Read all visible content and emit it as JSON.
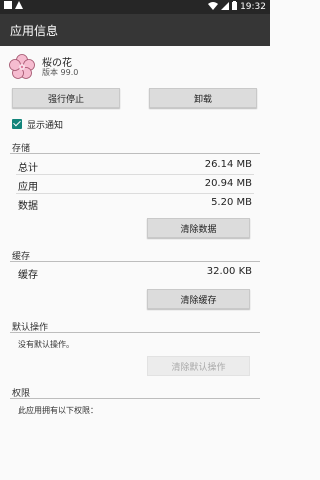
{
  "status_bar": {
    "time": "19:32",
    "icons": [
      "notification-square-icon",
      "notification-triangle-icon",
      "wifi-icon",
      "signal-icon",
      "battery-icon"
    ]
  },
  "app_bar": {
    "title": "应用信息"
  },
  "app": {
    "name": "桜の花",
    "version": "版本 99.0",
    "icon": "sakura-flower-icon"
  },
  "buttons": {
    "force_stop": "强行停止",
    "uninstall": "卸载",
    "clear_data": "清除数据",
    "clear_cache": "清除缓存",
    "clear_defaults": "清除默认操作"
  },
  "notifications": {
    "label": "显示通知",
    "checked": true
  },
  "storage": {
    "header": "存储",
    "rows": [
      {
        "label": "总计",
        "value": "26.14 MB"
      },
      {
        "label": "应用",
        "value": "20.94 MB"
      },
      {
        "label": "数据",
        "value": "5.20 MB"
      }
    ]
  },
  "cache": {
    "header": "缓存",
    "label": "缓存",
    "value": "32.00 KB"
  },
  "defaults": {
    "header": "默认操作",
    "text": "没有默认操作。"
  },
  "permissions": {
    "header": "权限",
    "text": "此应用拥有以下权限："
  },
  "colors": {
    "accent": "#11847a",
    "app_bar": "#363636",
    "status_bar": "#262626",
    "background": "#fafafa"
  }
}
